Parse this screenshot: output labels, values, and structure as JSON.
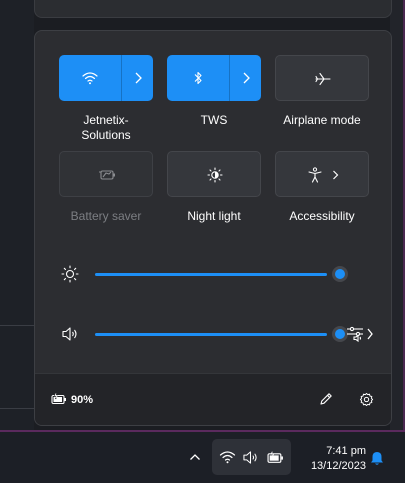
{
  "quick_settings": {
    "tiles": [
      {
        "label": "Jetnetix-\nSolutions",
        "icon": "wifi-icon",
        "state": "on"
      },
      {
        "label": "TWS",
        "icon": "bluetooth-icon",
        "state": "on"
      },
      {
        "label": "Airplane mode",
        "icon": "airplane-icon",
        "state": "off"
      },
      {
        "label": "Battery saver",
        "icon": "battery-saver-icon",
        "state": "disabled"
      },
      {
        "label": "Night light",
        "icon": "night-light-icon",
        "state": "off"
      },
      {
        "label": "Accessibility",
        "icon": "accessibility-icon",
        "state": "off"
      }
    ],
    "brightness": {
      "icon": "brightness-icon",
      "level": 1.0
    },
    "volume": {
      "icon": "speaker-icon",
      "level": 1.0
    },
    "footer": {
      "battery_percent": "90%",
      "battery_icon": "battery-charging-icon",
      "edit_icon": "pencil-icon",
      "settings_icon": "gear-icon"
    }
  },
  "taskbar": {
    "overflow_icon": "chevron-up-icon",
    "tray_icons": [
      "wifi-icon",
      "speaker-icon",
      "battery-charging-icon"
    ],
    "time": "7:41 pm",
    "date": "13/12/2023",
    "notification_icon": "bell-icon"
  },
  "colors": {
    "accent": "#1d8ff6",
    "panel": "#2c2d31",
    "taskbar": "#1c1f26"
  }
}
